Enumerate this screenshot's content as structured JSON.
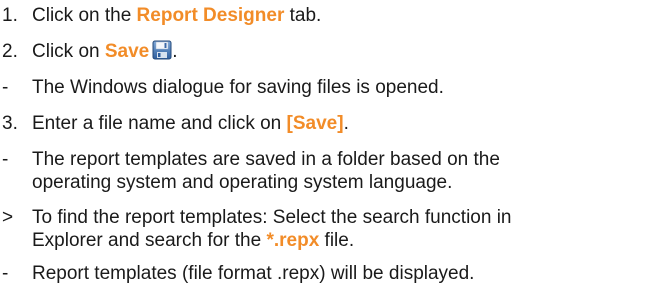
{
  "steps": [
    {
      "marker": "1.",
      "pre": "Click on the ",
      "highlight": "Report Designer",
      "post": " tab."
    },
    {
      "marker": "2.",
      "pre": "Click on ",
      "highlight": "Save",
      "post": ".",
      "icon": "floppy-disk-save-icon"
    },
    {
      "marker": "-",
      "text": "The Windows dialogue for saving files is opened."
    },
    {
      "marker": "3.",
      "pre": "Enter a file name and click on ",
      "highlight": "[Save]",
      "post": "."
    },
    {
      "marker": "-",
      "text_line1": "The report templates are saved in a folder based on the",
      "text_line2": "operating system and operating system language."
    },
    {
      "marker": ">",
      "pre_line1": "To find the report templates: Select the search function in",
      "pre_line2": "Explorer and search for the ",
      "highlight": "*.repx",
      "post": " file."
    },
    {
      "marker": "-",
      "text": "Report templates (file format .repx) will be displayed."
    }
  ],
  "colors": {
    "highlight": "#f28c28",
    "text": "#1a1a1a"
  }
}
